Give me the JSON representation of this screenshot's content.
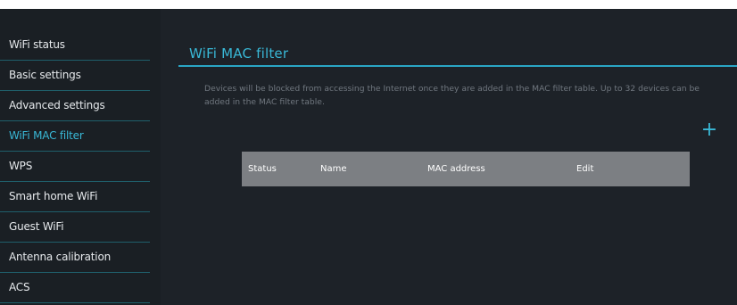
{
  "sidebar": {
    "items": [
      {
        "label": "WiFi status"
      },
      {
        "label": "Basic settings"
      },
      {
        "label": "Advanced settings"
      },
      {
        "label": "WiFi MAC filter"
      },
      {
        "label": "WPS"
      },
      {
        "label": "Smart home WiFi"
      },
      {
        "label": "Guest WiFi"
      },
      {
        "label": "Antenna calibration"
      },
      {
        "label": "ACS"
      }
    ],
    "active_index": 3
  },
  "main": {
    "title": "WiFi MAC filter",
    "description": "Devices will be blocked from accessing the Internet once they are added in the MAC filter table. Up to 32 devices can be added in the MAC filter table.",
    "add_icon": "plus-icon",
    "add_symbol": "+",
    "table": {
      "columns": [
        "Status",
        "Name",
        "MAC address",
        "Edit"
      ],
      "rows": []
    }
  },
  "colors": {
    "background": "#1a1f24",
    "accent": "#39b8d6",
    "header_bar": "#7c7f83"
  }
}
